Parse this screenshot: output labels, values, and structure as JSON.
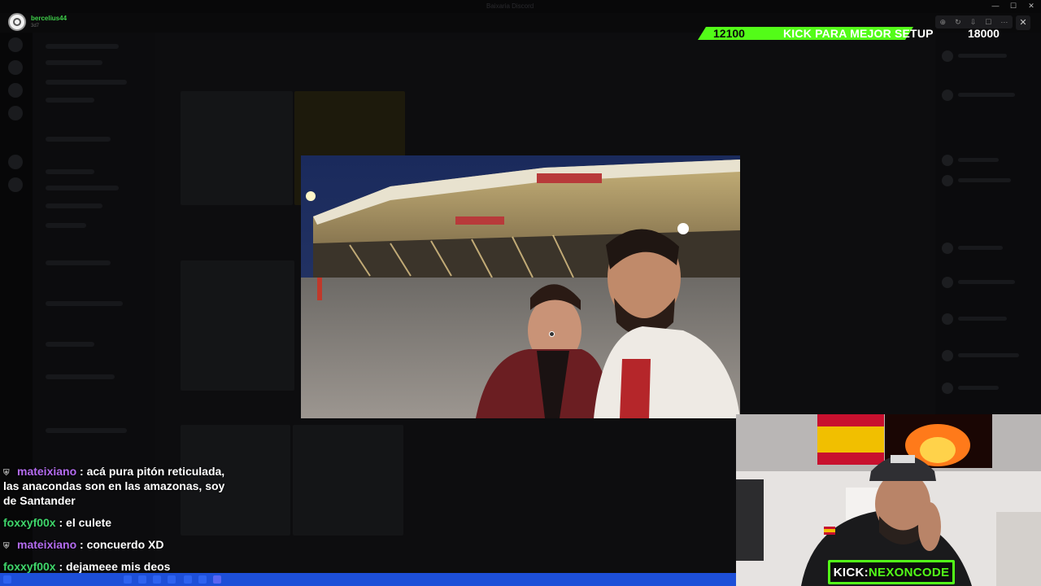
{
  "window": {
    "title": "Baixaria Discord",
    "controls": [
      "—",
      "☐",
      "✕"
    ]
  },
  "user_badge": {
    "name": "bercelius44",
    "sub": "3d7",
    "avatar_icon": "user-avatar-icon"
  },
  "goal": {
    "current": "12100",
    "label": "KICK PARA MEJOR SETUP",
    "target": "18000",
    "bar_color": "#53fc18",
    "fill_fraction": 0.672
  },
  "toolbar": {
    "tools": [
      "⊕",
      "↻",
      "⇩",
      "☐",
      "⋯"
    ],
    "close_label": "✕"
  },
  "chat": {
    "messages": [
      {
        "user": "mateixiano",
        "user_color": "purple",
        "text": "acá pura pitón reticulada, las anacondas son en las amazonas, soy de Santander"
      },
      {
        "user": "foxxyf00x",
        "user_color": "green",
        "text": "el culete"
      },
      {
        "user": "mateixiano",
        "user_color": "purple",
        "text": "concuerdo XD"
      },
      {
        "user": "foxxyf00x",
        "user_color": "green",
        "text": "dejameee mis deos"
      }
    ],
    "separator": " : "
  },
  "kick_tag": {
    "label": "KICK:",
    "name": "NEXONCODE",
    "accent": "#53fc18"
  }
}
